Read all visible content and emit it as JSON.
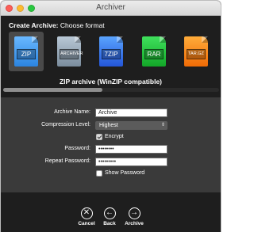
{
  "window": {
    "title": "Archiver"
  },
  "header": {
    "bold": "Create Archive:",
    "text": "Choose format"
  },
  "formats": [
    {
      "label": "ZIP",
      "selected": true,
      "color": "#2b84e0"
    },
    {
      "label": "ARCHIVER",
      "selected": false,
      "color": "#7a8c9c"
    },
    {
      "label": "7ZIP",
      "selected": false,
      "color": "#2456d9"
    },
    {
      "label": "RAR",
      "selected": false,
      "color": "#13a628"
    },
    {
      "label": "TAR.GZ",
      "selected": false,
      "color": "#f06b06"
    }
  ],
  "format_description": "ZIP archive (WinZIP compatible)",
  "format_scroll_fraction": 0.46,
  "form": {
    "archive_name_label": "Archive Name:",
    "archive_name_value": "Archive",
    "compression_label": "Compression Level:",
    "compression_value": "Highest",
    "encrypt_label": "Encrypt",
    "encrypt_checked": true,
    "password_label": "Password:",
    "password_value": "••••••••",
    "repeat_password_label": "Repeat Password:",
    "repeat_password_value": "•••••••••",
    "show_password_label": "Show Password",
    "show_password_checked": false
  },
  "actions": {
    "cancel": "Cancel",
    "back": "Back",
    "archive": "Archive"
  },
  "icons": {
    "cancel": "close-circle-icon",
    "back": "arrow-left-circle-icon",
    "archive": "arrow-right-circle-icon"
  }
}
